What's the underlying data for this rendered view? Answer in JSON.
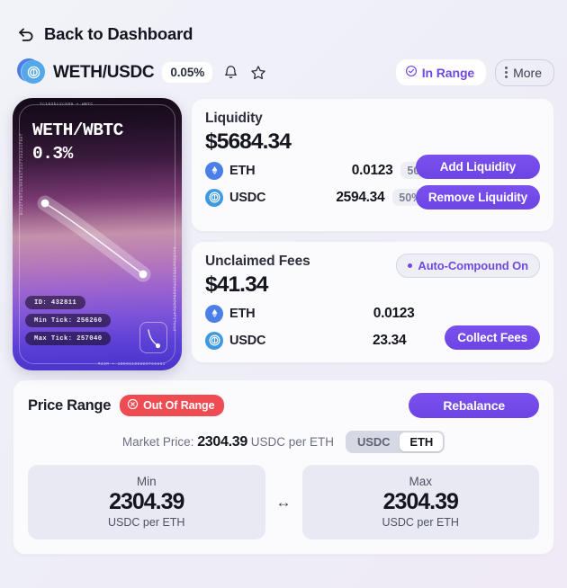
{
  "nav": {
    "back_label": "Back to Dashboard",
    "back_icon": "undo-arrow-icon"
  },
  "pair_header": {
    "pair_name": "WETH/USDC",
    "fee_tier": "0.05%",
    "bell_icon": "bell-icon",
    "star_icon": "star-icon",
    "status_pill": {
      "label": "In Range",
      "icon": "check-circle-icon",
      "color": "#6f4ae0"
    },
    "more_button": {
      "label": "More",
      "icon": "vertical-dots-icon"
    }
  },
  "nft_card": {
    "edge_top": "7c193bc2c599 • WBTC",
    "edge_left": "0x22f60f4c9e954f2a773aa44f0ef",
    "edge_right": "0xc02aa39b223fe8d0a0e5c4f27ead",
    "edge_bottom": "M33M • 2DD9G1DE8D9T5E602",
    "title": "WETH/WBTC",
    "fee": "0.3%",
    "badges": [
      "ID: 432811",
      "Min Tick: 256260",
      "Max Tick: 257040"
    ],
    "mini_icon": "curve-thumbnail-icon"
  },
  "liquidity": {
    "title": "Liquidity",
    "total": "$5684.34",
    "rows": [
      {
        "icon": "eth-token-icon",
        "symbol": "ETH",
        "amount": "0.0123",
        "percent": "50%"
      },
      {
        "icon": "usdc-token-icon",
        "symbol": "USDC",
        "amount": "2594.34",
        "percent": "50%"
      }
    ],
    "add_button": "Add Liquidity",
    "remove_button": "Remove Liquidity"
  },
  "fees": {
    "title": "Unclaimed Fees",
    "total": "$41.34",
    "auto_compound": {
      "label": "Auto-Compound On",
      "icon": "status-dot-icon"
    },
    "rows": [
      {
        "icon": "eth-token-icon",
        "symbol": "ETH",
        "amount": "0.0123"
      },
      {
        "icon": "usdc-token-icon",
        "symbol": "USDC",
        "amount": "23.34"
      }
    ],
    "collect_button": "Collect Fees"
  },
  "price_range": {
    "title": "Price Range",
    "status_badge": {
      "label": "Out Of Range",
      "icon": "x-circle-icon",
      "color": "#ef4b52"
    },
    "rebalance_button": "Rebalance",
    "market_price_label": "Market Price:",
    "market_price_value": "2304.39",
    "market_price_unit": "USDC per ETH",
    "denomination_toggle": {
      "options": [
        "USDC",
        "ETH"
      ],
      "selected": "ETH"
    },
    "min": {
      "label": "Min",
      "value": "2304.39",
      "unit": "USDC per ETH"
    },
    "max": {
      "label": "Max",
      "value": "2304.39",
      "unit": "USDC per ETH"
    },
    "range_arrow": "↔"
  },
  "theme": {
    "accent": "#6f4ae0",
    "danger": "#ef4b52",
    "background": "#f1f2f9"
  }
}
